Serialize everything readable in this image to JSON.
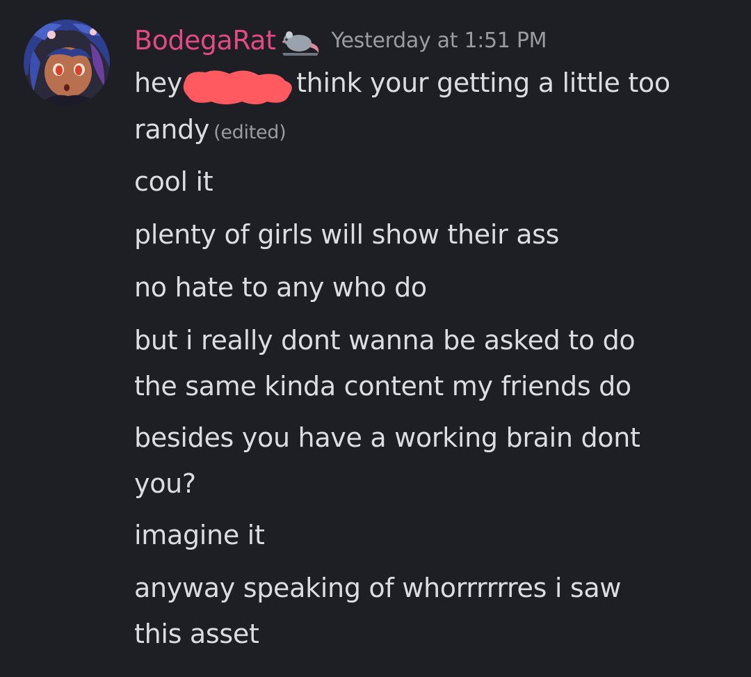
{
  "author": {
    "username": "BodegaRat",
    "name_color": "#e24a86",
    "badge_icon": "rat-icon"
  },
  "timestamp": "Yesterday at 1:51 PM",
  "message": {
    "line1_before": "hey",
    "line1_after": "think your getting a little too",
    "line2_text": "randy",
    "edited_label": "(edited)",
    "lines": [
      "cool it",
      "plenty of girls will show their ass",
      "no hate to any who do",
      "but i really dont wanna be asked to do",
      "the same kinda content my friends do",
      "besides you have a working brain dont",
      "you?",
      "imagine it",
      "anyway speaking of whorrrrrres i saw",
      "this asset"
    ]
  },
  "colors": {
    "background": "#1e1f24",
    "text": "#dcdde1",
    "muted": "#9a9ca3",
    "redaction": "#ff5a5f"
  }
}
